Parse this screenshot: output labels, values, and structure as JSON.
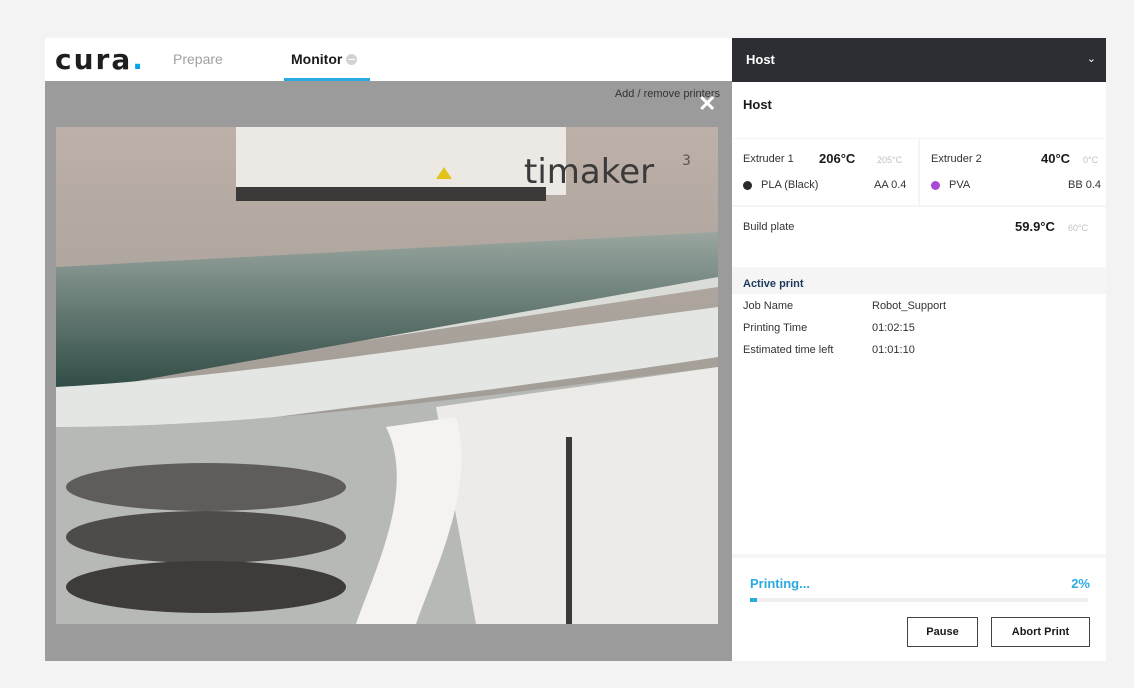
{
  "app": {
    "logo_text": "cura",
    "logo_dot": "."
  },
  "tabs": {
    "prepare": "Prepare",
    "monitor": "Monitor",
    "accent": "#2ba9e0"
  },
  "viewer": {
    "add_remove_printers": "Add / remove printers",
    "close_icon": "close-icon",
    "camera_text": "timaker",
    "camera_superscript": "3"
  },
  "sidebar": {
    "header_title": "Host",
    "chevron_icon": "chevron-down-icon",
    "host_title": "Host",
    "extruders": [
      {
        "name": "Extruder 1",
        "temp": "206°C",
        "target": "205°C",
        "material": "PLA (Black)",
        "material_color": "#2a2a2a",
        "nozzle": "AA 0.4"
      },
      {
        "name": "Extruder 2",
        "temp": "40°C",
        "target": "0°C",
        "material": "PVA",
        "material_color": "#a94ad6",
        "nozzle": "BB 0.4"
      }
    ],
    "build_plate": {
      "label": "Build plate",
      "temp": "59.9°C",
      "target": "60°C"
    },
    "active_print": {
      "heading": "Active print",
      "rows": [
        {
          "label": "Job Name",
          "value": "Robot_Support"
        },
        {
          "label": "Printing Time",
          "value": "01:02:15"
        },
        {
          "label": "Estimated time left",
          "value": "01:01:10"
        }
      ]
    },
    "status": {
      "label": "Printing...",
      "percent_text": "2%",
      "progress": 0.02
    },
    "buttons": {
      "pause": "Pause",
      "abort": "Abort Print"
    }
  }
}
